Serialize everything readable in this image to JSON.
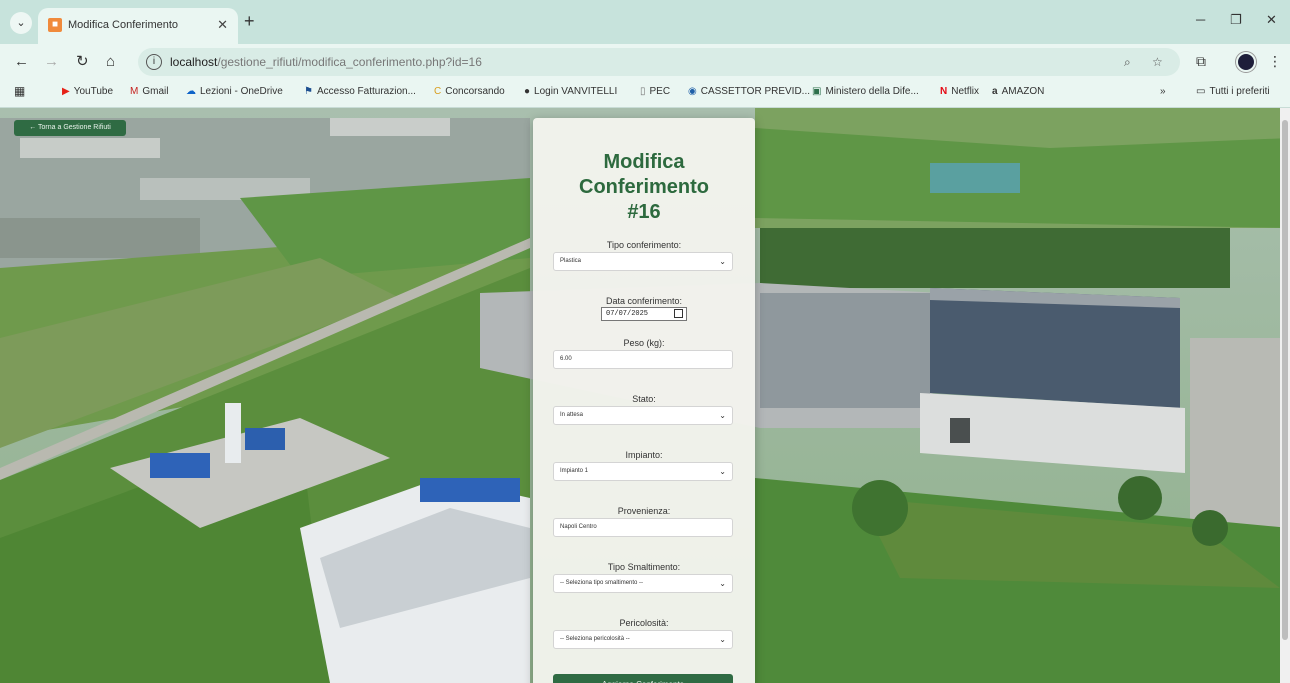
{
  "browser": {
    "tab_title": "Modifica Conferimento",
    "url_host": "localhost",
    "url_path": "/gestione_rifiuti/modifica_conferimento.php?id=16",
    "bookmarks": [
      {
        "icon": "youtube-icon",
        "label": "YouTube",
        "color": "#e62117"
      },
      {
        "icon": "gmail-icon",
        "label": "Gmail",
        "color": "#c5221f"
      },
      {
        "icon": "onedrive-icon",
        "label": "Lezioni - OneDrive",
        "color": "#0f64c8"
      },
      {
        "icon": "fatturazione-icon",
        "label": "Accesso Fatturazion...",
        "color": "#1d4f91"
      },
      {
        "icon": "concorsando-icon",
        "label": "Concorsando",
        "color": "#d89d1d"
      },
      {
        "icon": "login-icon",
        "label": "Login VANVITELLI",
        "color": "#333333"
      },
      {
        "icon": "pec-icon",
        "label": "PEC",
        "color": "#777777"
      },
      {
        "icon": "cassettoprevid-icon",
        "label": "CASSETTOR PREVID...",
        "color": "#1f5fa8"
      },
      {
        "icon": "ministero-icon",
        "label": "Ministero della Dife...",
        "color": "#2d6f4b"
      },
      {
        "icon": "netflix-icon",
        "label": "Netflix",
        "color": "#e50914"
      },
      {
        "icon": "amazon-icon",
        "label": "AMAZON",
        "color": "#222222"
      }
    ],
    "all_bookmarks": "Tutti i preferiti",
    "more_bookmarks": "»"
  },
  "page": {
    "back_button": "← Torna a Gestione Rifiuti",
    "title_line1": "Modifica",
    "title_line2": "Conferimento",
    "title_line3": "#16",
    "fields": {
      "tipo": {
        "label": "Tipo conferimento:",
        "value": "Plastica"
      },
      "data": {
        "label": "Data conferimento:",
        "value": "07/07/2025"
      },
      "peso": {
        "label": "Peso (kg):",
        "value": "6.00"
      },
      "stato": {
        "label": "Stato:",
        "value": "In attesa"
      },
      "impianto": {
        "label": "Impianto:",
        "value": "Impianto 1"
      },
      "provenienza": {
        "label": "Provenienza:",
        "value": "Napoli Centro"
      },
      "smaltimento": {
        "label": "Tipo Smaltimento:",
        "value": "-- Seleziona tipo smaltimento --"
      },
      "pericolosita": {
        "label": "Pericolosità:",
        "value": "-- Seleziona pericolosità --"
      }
    },
    "submit_label": "Aggiorna Conferimento"
  },
  "colors": {
    "accent": "#2d6a3e",
    "button": "#2f6b43",
    "chrome": "#c7e3dc"
  }
}
